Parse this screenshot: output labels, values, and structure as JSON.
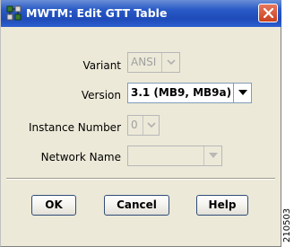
{
  "window": {
    "title": "MWTM:  Edit GTT Table",
    "icon": "mwtm-app-icon",
    "close_icon": "close-icon"
  },
  "form": {
    "variant": {
      "label": "Variant",
      "value": "ANSI",
      "enabled": false
    },
    "version": {
      "label": "Version",
      "value": "3.1 (MB9, MB9a)",
      "enabled": true
    },
    "instance_number": {
      "label": "Instance Number",
      "value": "0",
      "enabled": false
    },
    "network_name": {
      "label": "Network Name",
      "value": "",
      "enabled": false
    }
  },
  "buttons": {
    "ok": "OK",
    "cancel": "Cancel",
    "help": "Help"
  },
  "figure_id": "210503",
  "colors": {
    "titlebar": "#2a5bc7",
    "dialog_bg": "#ece9d8",
    "close_button": "#c9411d"
  }
}
